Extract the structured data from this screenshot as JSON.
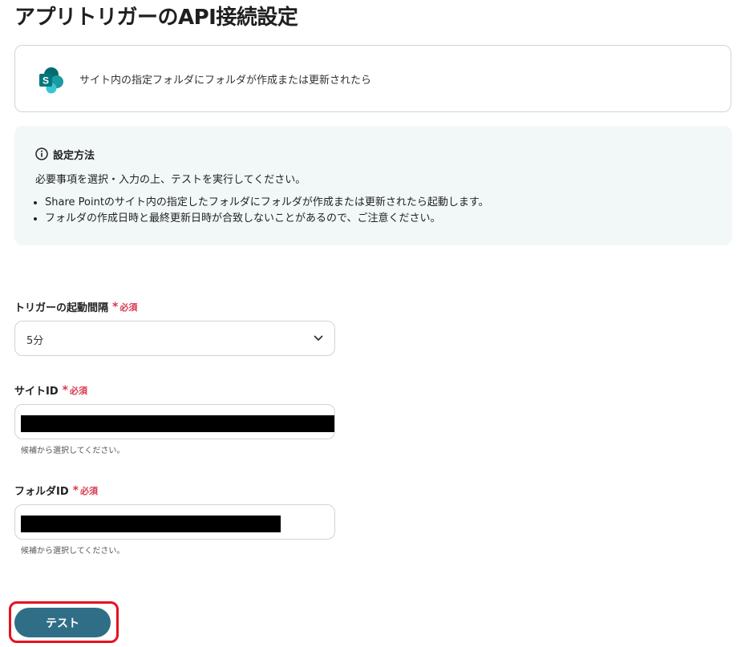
{
  "page": {
    "title": "アプリトリガーのAPI接続設定"
  },
  "trigger": {
    "app_icon": "sharepoint-icon",
    "text": "サイト内の指定フォルダにフォルダが作成または更新されたら"
  },
  "info": {
    "icon": "info-icon",
    "title": "設定方法",
    "description": "必要事項を選択・入力の上、テストを実行してください。",
    "bullets": [
      "Share Pointのサイト内の指定したフォルダにフォルダが作成または更新されたら起動します。",
      "フォルダの作成日時と最終更新日時が合致しないことがあるので、ご注意ください。"
    ]
  },
  "form": {
    "interval": {
      "label": "トリガーの起動間隔",
      "required_mark": "*",
      "required_text": "必須",
      "value": "5分"
    },
    "site_id": {
      "label": "サイトID",
      "required_mark": "*",
      "required_text": "必須",
      "value_redacted": true,
      "hint": "候補から選択してください。"
    },
    "folder_id": {
      "label": "フォルダID",
      "required_mark": "*",
      "required_text": "必須",
      "value_redacted": true,
      "hint": "候補から選択してください。"
    }
  },
  "actions": {
    "test_label": "テスト"
  },
  "colors": {
    "required": "#d9394e",
    "button": "#2f6e86",
    "info_background": "#f2f8f8",
    "highlight": "#e8101d"
  }
}
